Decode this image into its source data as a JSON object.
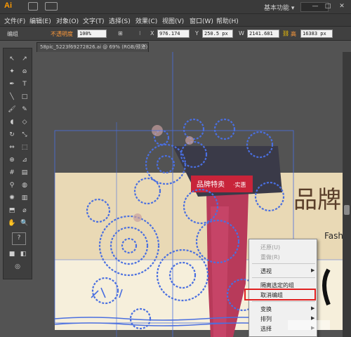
{
  "app": {
    "logo": "Ai",
    "workspace_label": "基本功能 ▾",
    "window_controls": [
      "—",
      "□",
      "✕"
    ]
  },
  "menubar": {
    "items": [
      "文件(F)",
      "编辑(E)",
      "对象(O)",
      "文字(T)",
      "选择(S)",
      "效果(C)",
      "视图(V)",
      "窗口(W)",
      "帮助(H)"
    ]
  },
  "controlbar": {
    "selection_label": "编组",
    "opacity_label": "不透明度",
    "opacity_value": "100%",
    "x_value": "976.174",
    "y_value": "250.5 px",
    "w_value": "2141.681",
    "h_label": "高",
    "h_value": "16383 px"
  },
  "document": {
    "tab_title": "58pic_5223f69272826.ai @ 69% (RGB/预览)",
    "close_glyph": "✕"
  },
  "artwork": {
    "banner_title": "品牌",
    "banner_subtitle": "Fash",
    "badge_text": "品牌特卖",
    "badge_sub": "·实惠"
  },
  "context_menu": {
    "items": [
      {
        "label": "还原(U)",
        "disabled": true
      },
      {
        "label": "重做(R)",
        "disabled": true
      },
      {
        "label": "透视",
        "disabled": false,
        "submenu": true
      },
      {
        "label": "隔离选定的组",
        "disabled": false
      },
      {
        "label": "取消编组",
        "disabled": false
      },
      {
        "label": "变换",
        "disabled": false,
        "submenu": true
      },
      {
        "label": "排列",
        "disabled": false,
        "submenu": true
      },
      {
        "label": "选择",
        "disabled": false,
        "submenu": true
      }
    ],
    "highlighted_item": "取消编组"
  },
  "toolbar": {
    "tools": [
      "selection-tool",
      "direct-selection-tool",
      "magic-wand-tool",
      "lasso-tool",
      "pen-tool",
      "type-tool",
      "line-tool",
      "rectangle-tool",
      "paintbrush-tool",
      "pencil-tool",
      "blob-brush-tool",
      "eraser-tool",
      "rotate-tool",
      "scale-tool",
      "width-tool",
      "free-transform-tool",
      "shape-builder-tool",
      "perspective-grid-tool",
      "mesh-tool",
      "gradient-tool",
      "eyedropper-tool",
      "blend-tool",
      "symbol-sprayer-tool",
      "column-graph-tool",
      "artboard-tool",
      "slice-tool",
      "hand-tool",
      "zoom-tool"
    ]
  },
  "colors": {
    "accent_orange": "#ff9a00",
    "selection_blue": "#4a6fe0",
    "highlight_red": "#e02020"
  }
}
